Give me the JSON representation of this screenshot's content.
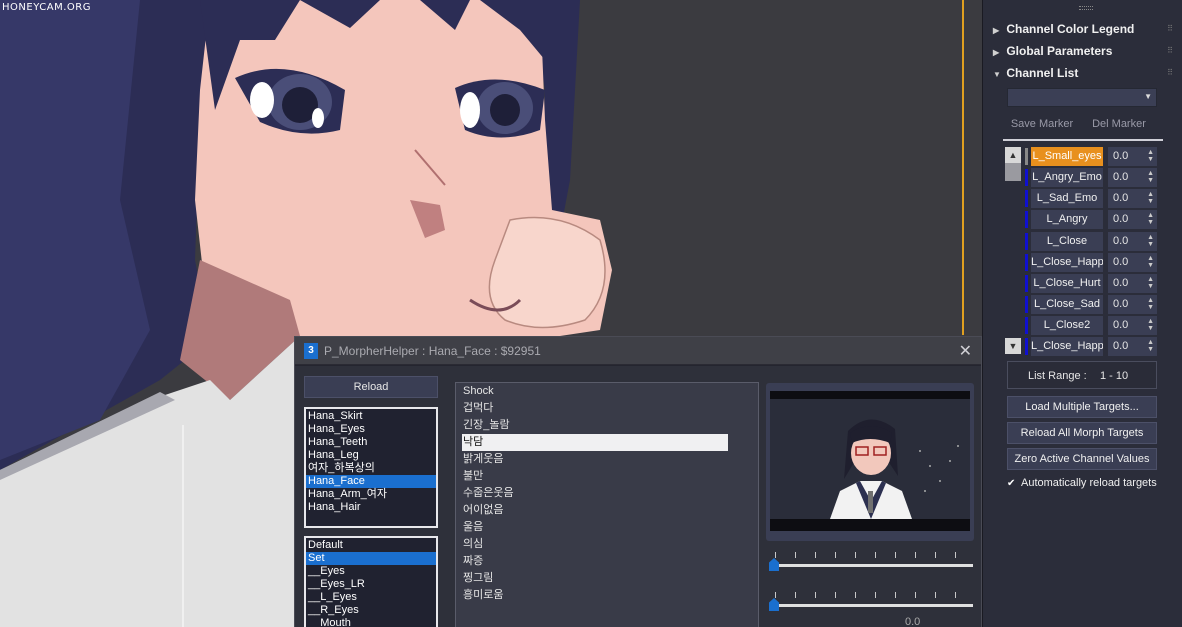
{
  "viewport": {
    "watermark": "HONEYCAM.ORG"
  },
  "right_panel": {
    "rollouts": [
      {
        "label": "Channel Color Legend",
        "expanded": false
      },
      {
        "label": "Global Parameters",
        "expanded": false
      },
      {
        "label": "Channel List",
        "expanded": true
      }
    ],
    "dropdown_value": "",
    "save_marker": "Save Marker",
    "del_marker": "Del Marker",
    "channels": [
      {
        "name": "L_Small_eyes",
        "value": "0.0",
        "active": true
      },
      {
        "name": "L_Angry_Emo",
        "value": "0.0"
      },
      {
        "name": "L_Sad_Emo",
        "value": "0.0"
      },
      {
        "name": "L_Angry",
        "value": "0.0"
      },
      {
        "name": "L_Close",
        "value": "0.0"
      },
      {
        "name": "L_Close_Happy",
        "value": "0.0"
      },
      {
        "name": "L_Close_Hurt",
        "value": "0.0"
      },
      {
        "name": "L_Close_Sad",
        "value": "0.0"
      },
      {
        "name": "L_Close2",
        "value": "0.0"
      },
      {
        "name": "L_Close_Happy",
        "value": "0.0"
      }
    ],
    "list_range_label": "List Range :",
    "list_range_value": "1 - 10",
    "buttons": {
      "load_multiple": "Load Multiple Targets...",
      "reload_all": "Reload All Morph Targets",
      "zero_active": "Zero Active Channel Values"
    },
    "auto_reload": {
      "label": "Automatically reload targets",
      "checked": true
    }
  },
  "dialog": {
    "title": "P_MorpherHelper : Hana_Face : $92951",
    "icon_glyph": "3",
    "reload": "Reload",
    "objects": [
      "Hana_Skirt",
      "Hana_Eyes",
      "Hana_Teeth",
      "Hana_Leg",
      "여자_하복상의",
      "Hana_Face",
      "Hana_Arm_여자",
      "Hana_Hair"
    ],
    "objects_selected": 5,
    "sets": [
      "Default",
      "Set",
      "__Eyes",
      "__Eyes_LR",
      "__L_Eyes",
      "__R_Eyes",
      "__Mouth"
    ],
    "sets_selected": 1,
    "morphs": [
      "Shock",
      "겁먹다",
      "긴장_놀람",
      "낙담",
      "밝게웃음",
      "불만",
      "수줍은웃음",
      "어이없음",
      "울음",
      "의심",
      "짜증",
      "찡그림",
      "흥미로움"
    ],
    "morphs_selected": 3,
    "spinner_value": "0.0"
  },
  "colors": {
    "accent_orange": "#e8901e",
    "selection_blue": "#1a6fcf",
    "channel_bar_blue": "#1010d0"
  }
}
